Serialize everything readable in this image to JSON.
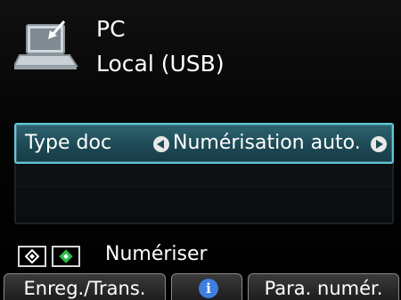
{
  "header": {
    "destination": "PC",
    "connection": "Local (USB)",
    "icon": "laptop-icon"
  },
  "setting": {
    "label": "Type doc",
    "value": "Numérisation auto."
  },
  "footer": {
    "scan_label": "Numériser",
    "softkeys": {
      "left": "Enreg./Trans.",
      "middle_icon": "info-icon",
      "middle_glyph": "i",
      "right": "Para. numér."
    }
  },
  "colors": {
    "selection_border": "#5fc8d8",
    "selection_fill": "#1d4a55",
    "start_color_key": "#2fb84a",
    "info_icon": "#3f7fe0"
  }
}
